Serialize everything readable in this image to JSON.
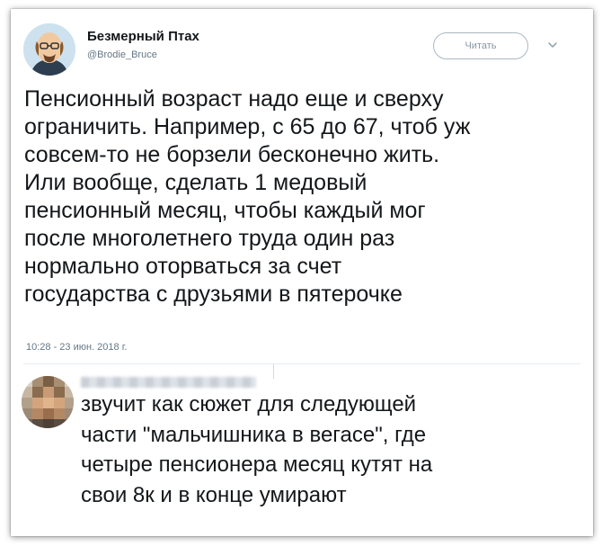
{
  "tweet": {
    "author_name": "Безмерный Птах",
    "author_handle": "@Brodie_Bruce",
    "follow_label": "Читать",
    "text": "Пенсионный возраст надо еще и сверху\nограничить. Например, с 65 до 67, чтоб уж\nсовсем-то не борзели бесконечно жить.\nИли вообще, сделать 1 медовый\nпенсионный месяц, чтобы каждый мог\nпосле многолетнего труда один раз\nнормально оторваться за счет\nгосударства с друзьями в пятерочке",
    "timestamp": "10:28 - 23 июн. 2018 г."
  },
  "reply": {
    "text": "звучит как сюжет для следующей\nчасти \"мальчишника в вегасе\", где\nчетыре пенсионера месяц кутят на\nсвои 8к и в конце умирают"
  },
  "icons": {
    "author_avatar": "cartoon-bald-man-avatar",
    "follow_menu": "chevron-down-icon",
    "reply_avatar": "pixelated-avatar"
  },
  "colors": {
    "text": "#14171a",
    "secondary": "#657786",
    "button_border": "#aab8c2"
  }
}
